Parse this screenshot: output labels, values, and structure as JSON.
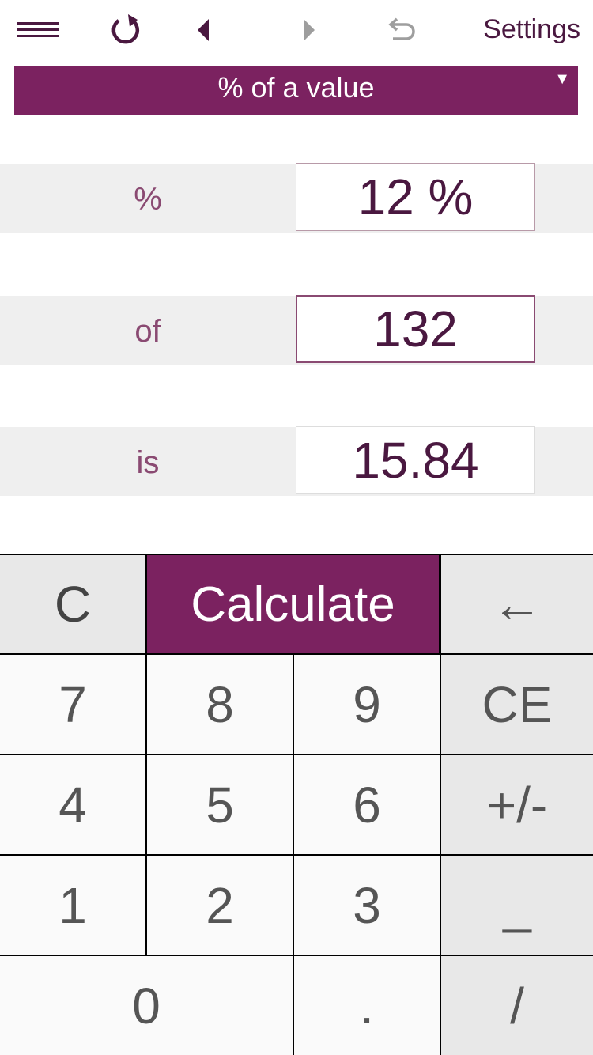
{
  "toolbar": {
    "menu_icon": "hamburger-menu-icon",
    "reset_icon": "reset-rotate-icon",
    "prev_icon": "triangle-left-icon",
    "next_icon": "triangle-right-icon",
    "undo_icon": "undo-arrow-icon",
    "settings_label": "Settings"
  },
  "mode": {
    "selected": "% of a value",
    "caret": "▼"
  },
  "rows": [
    {
      "label": "%",
      "value": "12 %"
    },
    {
      "label": "of",
      "value": "132"
    },
    {
      "label": "is",
      "value": "15.84"
    }
  ],
  "keypad": {
    "clear": "C",
    "calculate": "Calculate",
    "backspace": "←",
    "k7": "7",
    "k8": "8",
    "k9": "9",
    "ce": "CE",
    "k4": "4",
    "k5": "5",
    "k6": "6",
    "sign": "+/-",
    "k1": "1",
    "k2": "2",
    "k3": "3",
    "underscore": "_",
    "k0": "0",
    "dot": ".",
    "slash": "/"
  },
  "colors": {
    "brand": "#7b2260",
    "text_dark": "#4a1840",
    "label": "#8a4a72",
    "band": "#efefef"
  }
}
